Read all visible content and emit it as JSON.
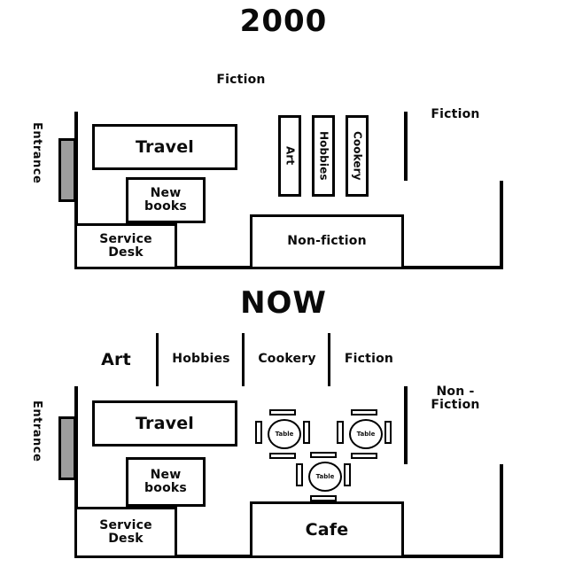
{
  "page": {
    "subject": "Library floor plan comparison"
  },
  "plan_2000": {
    "title": "2000",
    "entrance_label": "Entrance",
    "areas": {
      "fiction_band": "Fiction",
      "fiction_room": "Fiction",
      "travel": "Travel",
      "new_books": "New books",
      "new_books_line1": "New",
      "new_books_line2": "books",
      "service_desk_line1": "Service",
      "service_desk_line2": "Desk",
      "non_fiction": "Non-fiction"
    },
    "shelves": [
      {
        "label": "Art"
      },
      {
        "label": "Hobbies"
      },
      {
        "label": "Cookery"
      }
    ]
  },
  "plan_now": {
    "title": "NOW",
    "entrance_label": "Entrance",
    "top_shelves": [
      {
        "label": "Art"
      },
      {
        "label": "Hobbies"
      },
      {
        "label": "Cookery"
      },
      {
        "label": "Fiction"
      }
    ],
    "areas": {
      "non_fiction_line1": "Non -",
      "non_fiction_line2": "Fiction",
      "travel": "Travel",
      "new_books_line1": "New",
      "new_books_line2": "books",
      "service_desk_line1": "Service",
      "service_desk_line2": "Desk",
      "cafe": "Cafe"
    },
    "tables": [
      {
        "label": "Table"
      },
      {
        "label": "Table"
      },
      {
        "label": "Table"
      }
    ]
  },
  "colors": {
    "ink": "#000000",
    "paper": "#ffffff",
    "door_fill": "#9d9d9d"
  }
}
